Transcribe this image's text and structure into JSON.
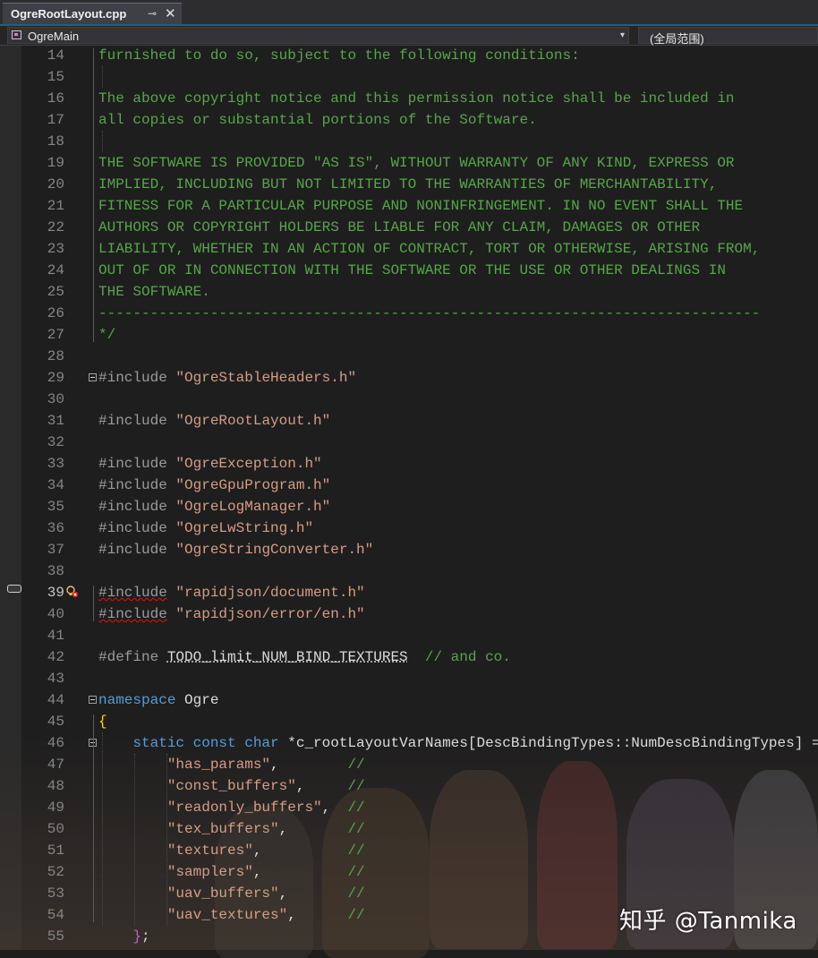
{
  "tab": {
    "title": "OgreRootLayout.cpp",
    "pin_icon": "pin-icon",
    "close_glyph": "✕"
  },
  "navbar": {
    "scope": "OgreMain",
    "member": "(全局范围)",
    "arrow": "▾"
  },
  "watermark": "知乎 @Tanmika",
  "lines": [
    {
      "num": "14",
      "segments": [
        {
          "t": "furnished to do so, subject to the following conditions:",
          "c": "cm"
        }
      ]
    },
    {
      "num": "15",
      "segments": []
    },
    {
      "num": "16",
      "segments": [
        {
          "t": "The above copyright notice and this permission notice shall be included in",
          "c": "cm"
        }
      ]
    },
    {
      "num": "17",
      "segments": [
        {
          "t": "all copies or substantial portions of the Software.",
          "c": "cm"
        }
      ]
    },
    {
      "num": "18",
      "segments": []
    },
    {
      "num": "19",
      "segments": [
        {
          "t": "THE SOFTWARE IS PROVIDED \"AS IS\", WITHOUT WARRANTY OF ANY KIND, EXPRESS OR",
          "c": "cm"
        }
      ]
    },
    {
      "num": "20",
      "segments": [
        {
          "t": "IMPLIED, INCLUDING BUT NOT LIMITED TO THE WARRANTIES OF MERCHANTABILITY,",
          "c": "cm"
        }
      ]
    },
    {
      "num": "21",
      "segments": [
        {
          "t": "FITNESS FOR A PARTICULAR PURPOSE AND NONINFRINGEMENT. IN NO EVENT SHALL THE",
          "c": "cm"
        }
      ]
    },
    {
      "num": "22",
      "segments": [
        {
          "t": "AUTHORS OR COPYRIGHT HOLDERS BE LIABLE FOR ANY CLAIM, DAMAGES OR OTHER",
          "c": "cm"
        }
      ]
    },
    {
      "num": "23",
      "segments": [
        {
          "t": "LIABILITY, WHETHER IN AN ACTION OF CONTRACT, TORT OR OTHERWISE, ARISING FROM,",
          "c": "cm"
        }
      ]
    },
    {
      "num": "24",
      "segments": [
        {
          "t": "OUT OF OR IN CONNECTION WITH THE SOFTWARE OR THE USE OR OTHER DEALINGS IN",
          "c": "cm"
        }
      ]
    },
    {
      "num": "25",
      "segments": [
        {
          "t": "THE SOFTWARE.",
          "c": "cm"
        }
      ]
    },
    {
      "num": "26",
      "segments": [
        {
          "t": "-----------------------------------------------------------------------------",
          "c": "cm"
        }
      ]
    },
    {
      "num": "27",
      "segments": [
        {
          "t": "*/",
          "c": "cm"
        }
      ]
    },
    {
      "num": "28",
      "segments": []
    },
    {
      "num": "29",
      "segments": [
        {
          "t": "#include ",
          "c": "pp"
        },
        {
          "t": "\"OgreStableHeaders.h\"",
          "c": "str"
        }
      ]
    },
    {
      "num": "30",
      "segments": []
    },
    {
      "num": "31",
      "segments": [
        {
          "t": "#include ",
          "c": "pp"
        },
        {
          "t": "\"OgreRootLayout.h\"",
          "c": "str"
        }
      ]
    },
    {
      "num": "32",
      "segments": []
    },
    {
      "num": "33",
      "segments": [
        {
          "t": "#include ",
          "c": "pp"
        },
        {
          "t": "\"OgreException.h\"",
          "c": "str"
        }
      ]
    },
    {
      "num": "34",
      "segments": [
        {
          "t": "#include ",
          "c": "pp"
        },
        {
          "t": "\"OgreGpuProgram.h\"",
          "c": "str"
        }
      ]
    },
    {
      "num": "35",
      "segments": [
        {
          "t": "#include ",
          "c": "pp"
        },
        {
          "t": "\"OgreLogManager.h\"",
          "c": "str"
        }
      ]
    },
    {
      "num": "36",
      "segments": [
        {
          "t": "#include ",
          "c": "pp"
        },
        {
          "t": "\"OgreLwString.h\"",
          "c": "str"
        }
      ]
    },
    {
      "num": "37",
      "segments": [
        {
          "t": "#include ",
          "c": "pp"
        },
        {
          "t": "\"OgreStringConverter.h\"",
          "c": "str"
        }
      ]
    },
    {
      "num": "38",
      "segments": []
    },
    {
      "num": "39",
      "segments": [
        {
          "t": "#include",
          "c": "pp sq"
        },
        {
          "t": " ",
          "c": "pp"
        },
        {
          "t": "\"rapidjson/document.h\"",
          "c": "str"
        }
      ]
    },
    {
      "num": "40",
      "segments": [
        {
          "t": "#include",
          "c": "pp sq"
        },
        {
          "t": " ",
          "c": "pp"
        },
        {
          "t": "\"rapidjson/error/en.h\"",
          "c": "str"
        }
      ]
    },
    {
      "num": "41",
      "segments": []
    },
    {
      "num": "42",
      "segments": [
        {
          "t": "#define ",
          "c": "pp"
        },
        {
          "t": "TODO_limit_NUM_BIND_TEXTURES",
          "c": "ul"
        },
        {
          "t": "  ",
          "c": ""
        },
        {
          "t": "// and co.",
          "c": "cm"
        }
      ]
    },
    {
      "num": "43",
      "segments": []
    },
    {
      "num": "44",
      "segments": [
        {
          "t": "namespace",
          "c": "kw"
        },
        {
          "t": " Ogre",
          "c": ""
        }
      ]
    },
    {
      "num": "45",
      "segments": [
        {
          "t": "{",
          "c": "br"
        }
      ]
    },
    {
      "num": "46",
      "segments": [
        {
          "t": "    ",
          "c": ""
        },
        {
          "t": "static const char",
          "c": "kw"
        },
        {
          "t": " *c_rootLayoutVarNames[DescBindingTypes::NumDescBindingTypes] = ",
          "c": ""
        },
        {
          "t": "{",
          "c": "mac"
        }
      ]
    },
    {
      "num": "47",
      "segments": [
        {
          "t": "        ",
          "c": ""
        },
        {
          "t": "\"has_params\"",
          "c": "str"
        },
        {
          "t": ",        ",
          "c": ""
        },
        {
          "t": "//",
          "c": "cm"
        }
      ]
    },
    {
      "num": "48",
      "segments": [
        {
          "t": "        ",
          "c": ""
        },
        {
          "t": "\"const_buffers\"",
          "c": "str"
        },
        {
          "t": ",     ",
          "c": ""
        },
        {
          "t": "//",
          "c": "cm"
        }
      ]
    },
    {
      "num": "49",
      "segments": [
        {
          "t": "        ",
          "c": ""
        },
        {
          "t": "\"readonly_buffers\"",
          "c": "str"
        },
        {
          "t": ",  ",
          "c": ""
        },
        {
          "t": "//",
          "c": "cm"
        }
      ]
    },
    {
      "num": "50",
      "segments": [
        {
          "t": "        ",
          "c": ""
        },
        {
          "t": "\"tex_buffers\"",
          "c": "str"
        },
        {
          "t": ",       ",
          "c": ""
        },
        {
          "t": "//",
          "c": "cm"
        }
      ]
    },
    {
      "num": "51",
      "segments": [
        {
          "t": "        ",
          "c": ""
        },
        {
          "t": "\"textures\"",
          "c": "str"
        },
        {
          "t": ",          ",
          "c": ""
        },
        {
          "t": "//",
          "c": "cm"
        }
      ]
    },
    {
      "num": "52",
      "segments": [
        {
          "t": "        ",
          "c": ""
        },
        {
          "t": "\"samplers\"",
          "c": "str"
        },
        {
          "t": ",          ",
          "c": ""
        },
        {
          "t": "//",
          "c": "cm"
        }
      ]
    },
    {
      "num": "53",
      "segments": [
        {
          "t": "        ",
          "c": ""
        },
        {
          "t": "\"uav_buffers\"",
          "c": "str"
        },
        {
          "t": ",       ",
          "c": ""
        },
        {
          "t": "//",
          "c": "cm"
        }
      ]
    },
    {
      "num": "54",
      "segments": [
        {
          "t": "        ",
          "c": ""
        },
        {
          "t": "\"uav_textures\"",
          "c": "str"
        },
        {
          "t": ",      ",
          "c": ""
        },
        {
          "t": "//",
          "c": "cm"
        }
      ]
    },
    {
      "num": "55",
      "segments": [
        {
          "t": "    ",
          "c": ""
        },
        {
          "t": "}",
          "c": "mac"
        },
        {
          "t": ";",
          "c": ""
        }
      ]
    }
  ],
  "active_line": "39",
  "fold_lines": [
    "29",
    "44",
    "46"
  ],
  "colors": {
    "comment": "#57a64a",
    "keyword": "#569cd6",
    "string": "#d69d85",
    "preprocessor": "#9b9b9b",
    "brace": "#ffd700",
    "accent": "#0e639c"
  }
}
